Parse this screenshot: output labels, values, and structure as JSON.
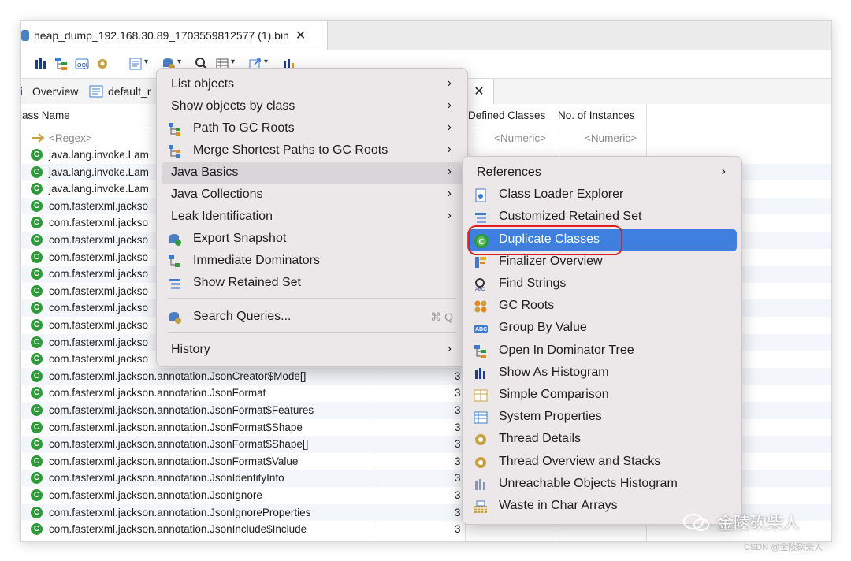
{
  "editor_tab": {
    "title": "heap_dump_192.168.30.89_1703559812577 (1).bin",
    "close": "✕"
  },
  "subtabs": {
    "overview": "Overview",
    "default_prefix": "default_r",
    "close": "✕"
  },
  "columns": {
    "class_name": "lass Name",
    "defined_classes": "Defined Classes",
    "instances": "No. of Instances"
  },
  "filter_row": {
    "regex": "<Regex>",
    "numeric1": "<Numeric>",
    "numeric2": "<Numeric>"
  },
  "rows": [
    {
      "name": "java.lang.invoke.Lam",
      "value": ""
    },
    {
      "name": "java.lang.invoke.Lam",
      "value": ""
    },
    {
      "name": "java.lang.invoke.Lam",
      "value": ""
    },
    {
      "name": "com.fasterxml.jackso",
      "value": ""
    },
    {
      "name": "com.fasterxml.jackso",
      "value": ""
    },
    {
      "name": "com.fasterxml.jackso",
      "value": ""
    },
    {
      "name": "com.fasterxml.jackso",
      "value": ""
    },
    {
      "name": "com.fasterxml.jackso",
      "value": ""
    },
    {
      "name": "com.fasterxml.jackso",
      "value": ""
    },
    {
      "name": "com.fasterxml.jackso",
      "value": ""
    },
    {
      "name": "com.fasterxml.jackso",
      "value": ""
    },
    {
      "name": "com.fasterxml.jackso",
      "value": ""
    },
    {
      "name": "com.fasterxml.jackso",
      "value": ""
    },
    {
      "name": "com.fasterxml.jackson.annotation.JsonCreator$Mode[]",
      "value": "3"
    },
    {
      "name": "com.fasterxml.jackson.annotation.JsonFormat",
      "value": "3"
    },
    {
      "name": "com.fasterxml.jackson.annotation.JsonFormat$Features",
      "value": "3"
    },
    {
      "name": "com.fasterxml.jackson.annotation.JsonFormat$Shape",
      "value": "3"
    },
    {
      "name": "com.fasterxml.jackson.annotation.JsonFormat$Shape[]",
      "value": "3"
    },
    {
      "name": "com.fasterxml.jackson.annotation.JsonFormat$Value",
      "value": "3"
    },
    {
      "name": "com.fasterxml.jackson.annotation.JsonIdentityInfo",
      "value": "3"
    },
    {
      "name": "com.fasterxml.jackson.annotation.JsonIgnore",
      "value": "3"
    },
    {
      "name": "com.fasterxml.jackson.annotation.JsonIgnoreProperties",
      "value": "3"
    },
    {
      "name": "com.fasterxml.jackson.annotation.JsonInclude$Include",
      "value": "3"
    }
  ],
  "context_menu": {
    "items": [
      {
        "label": "List objects"
      },
      {
        "label": "Show objects by class"
      },
      {
        "label": "Path To GC Roots"
      },
      {
        "label": "Merge Shortest Paths to GC Roots"
      },
      {
        "label": "Java Basics"
      },
      {
        "label": "Java Collections"
      },
      {
        "label": "Leak Identification"
      },
      {
        "label": "Export Snapshot"
      },
      {
        "label": "Immediate Dominators"
      },
      {
        "label": "Show Retained Set"
      },
      {
        "label": "Search Queries..."
      },
      {
        "label": "History"
      }
    ],
    "search_shortcut": "⌘ Q",
    "arrow": "›"
  },
  "submenu": {
    "items": [
      {
        "label": "References"
      },
      {
        "label": "Class Loader Explorer"
      },
      {
        "label": "Customized Retained Set"
      },
      {
        "label": "Duplicate Classes"
      },
      {
        "label": "Finalizer Overview"
      },
      {
        "label": "Find Strings"
      },
      {
        "label": "GC Roots"
      },
      {
        "label": "Group By Value"
      },
      {
        "label": "Open In Dominator Tree"
      },
      {
        "label": "Show As Histogram"
      },
      {
        "label": "Simple Comparison"
      },
      {
        "label": "System Properties"
      },
      {
        "label": "Thread Details"
      },
      {
        "label": "Thread Overview and Stacks"
      },
      {
        "label": "Unreachable Objects Histogram"
      },
      {
        "label": "Waste in Char Arrays"
      }
    ],
    "selected": "Duplicate Classes",
    "selected_color": "#3e7fe0",
    "highlight_color": "#e02020"
  },
  "watermark": {
    "text": "金陵砍柴人",
    "sub": "CSDN @金陵砍柴人"
  }
}
